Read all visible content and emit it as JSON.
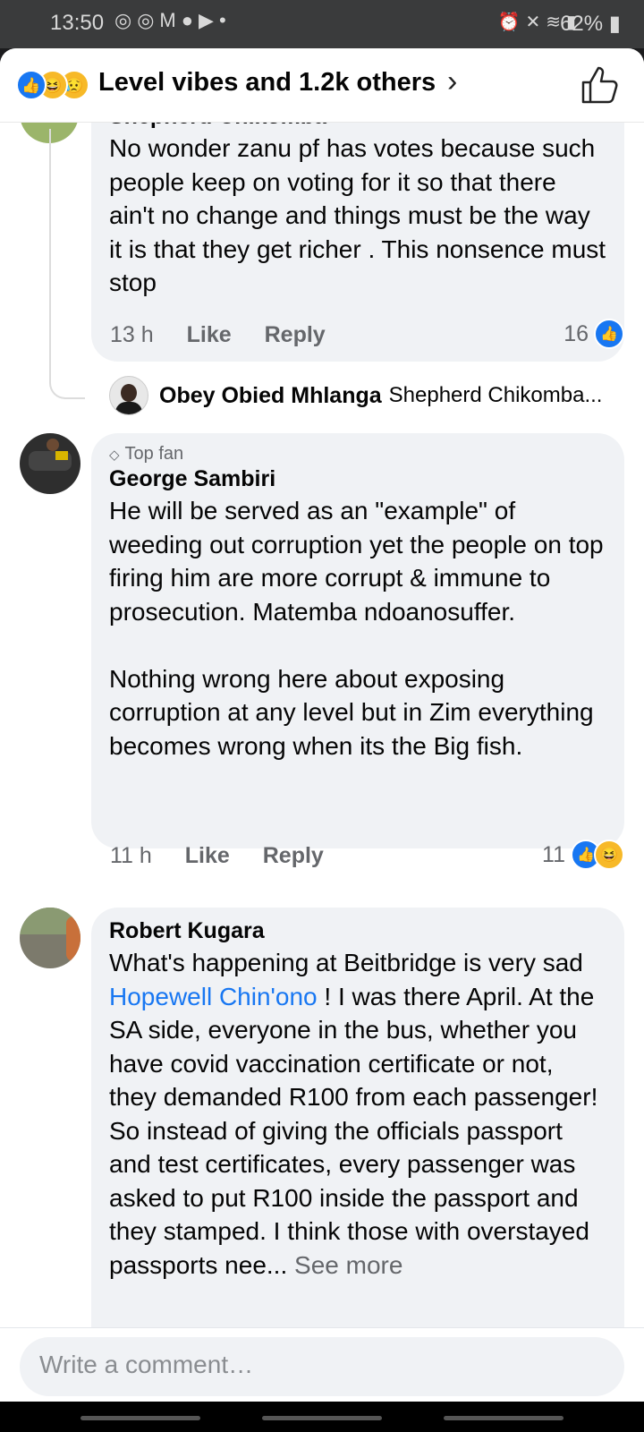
{
  "status_bar": {
    "time": "13:50",
    "battery": "62%",
    "left_icons": [
      "whatsapp-icon",
      "whatsapp-icon",
      "gmail-icon",
      "facebook-icon",
      "youtube-icon",
      "dot-icon"
    ],
    "right_icons": [
      "alarm-icon",
      "mute-icon",
      "wifi-icon",
      "signal-icon",
      "battery-icon"
    ]
  },
  "reactions_header": {
    "label": "Level vibes and 1.2k others",
    "chevron": "›",
    "reaction_icons": [
      "like",
      "haha",
      "sad"
    ]
  },
  "comments": [
    {
      "author": "Shepherd Chikomba",
      "text": "No wonder zanu pf has votes because such people keep on voting for it so that there ain't no change and things must be the way it is that they get richer . This nonsence must stop",
      "time": "13 h",
      "like_label": "Like",
      "reply_label": "Reply",
      "reaction_count": "16",
      "reply_preview": {
        "author": "Obey Obied Mhlanga",
        "text": "Shepherd Chikomba..."
      }
    },
    {
      "badge": "Top fan",
      "author": "George Sambiri",
      "text": "He will be served as an \"example\" of weeding out corruption yet the people on top firing him are more corrupt & immune to prosecution. Matemba ndoanosuffer.\n\nNothing wrong here about exposing corruption at any level but in Zim everything becomes wrong when its the Big fish.",
      "time": "11 h",
      "like_label": "Like",
      "reply_label": "Reply",
      "reaction_count": "11"
    },
    {
      "author": "Robert Kugara",
      "text_before": "What's happening at Beitbridge is very sad ",
      "mention": "Hopewell Chin'ono",
      "text_after": " ! I was there April. At the SA side, everyone in the bus, whether you have covid vaccination certificate or not, they demanded R100 from each passenger! So instead of giving the officials passport and test certificates, every passenger was asked to put R100 inside the passport and they stamped. I think those with overstayed passports nee...",
      "see_more": " See more"
    }
  ],
  "composer": {
    "placeholder": "Write a comment…"
  },
  "colors": {
    "accent": "#1877f2",
    "bubble": "#f0f2f5",
    "muted_text": "#65676b"
  }
}
